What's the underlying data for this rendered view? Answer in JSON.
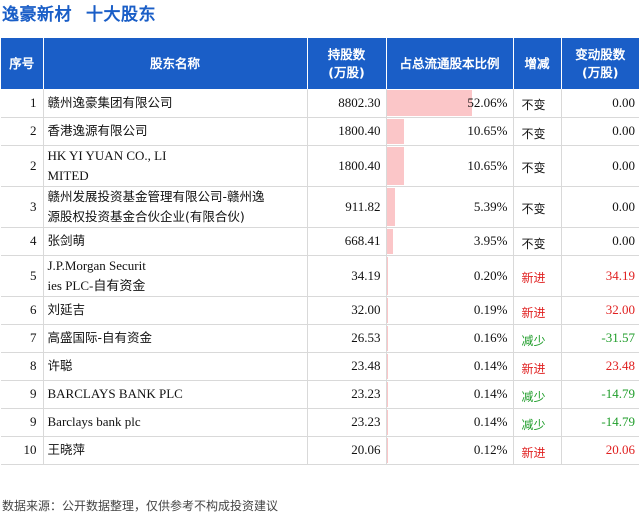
{
  "title": {
    "company": "逸豪新材",
    "section": "十大股东"
  },
  "table": {
    "headers": [
      "序号",
      "股东名称",
      "持股数\n(万股)",
      "占总流通股本比例",
      "增减",
      "变动股数\n(万股)"
    ],
    "rows": [
      {
        "rank": "1",
        "name": [
          "赣州逸豪集团有限公司"
        ],
        "shares": "8802.30",
        "pct": "52.06%",
        "pct_value": 52.06,
        "change": "不变",
        "change_type": "same",
        "delta": "0.00"
      },
      {
        "rank": "2",
        "name": [
          "香港逸源有限公司"
        ],
        "shares": "1800.40",
        "pct": "10.65%",
        "pct_value": 10.65,
        "change": "不变",
        "change_type": "same",
        "delta": "0.00"
      },
      {
        "rank": "2",
        "name": [
          "HK YI YUAN CO., LI",
          "MITED"
        ],
        "shares": "1800.40",
        "pct": "10.65%",
        "pct_value": 10.65,
        "change": "不变",
        "change_type": "same",
        "delta": "0.00"
      },
      {
        "rank": "3",
        "name": [
          "赣州发展投资基金管理有限公司-赣州逸",
          "源股权投资基金合伙企业(有限合伙)"
        ],
        "shares": "911.82",
        "pct": "5.39%",
        "pct_value": 5.39,
        "change": "不变",
        "change_type": "same",
        "delta": "0.00"
      },
      {
        "rank": "4",
        "name": [
          "张剑萌"
        ],
        "shares": "668.41",
        "pct": "3.95%",
        "pct_value": 3.95,
        "change": "不变",
        "change_type": "same",
        "delta": "0.00"
      },
      {
        "rank": "5",
        "name": [
          "J.P.Morgan Securit",
          "ies PLC-自有资金"
        ],
        "shares": "34.19",
        "pct": "0.20%",
        "pct_value": 0.2,
        "change": "新进",
        "change_type": "new",
        "delta": "34.19"
      },
      {
        "rank": "6",
        "name": [
          "刘延吉"
        ],
        "shares": "32.00",
        "pct": "0.19%",
        "pct_value": 0.19,
        "change": "新进",
        "change_type": "new",
        "delta": "32.00"
      },
      {
        "rank": "7",
        "name": [
          "高盛国际-自有资金"
        ],
        "shares": "26.53",
        "pct": "0.16%",
        "pct_value": 0.16,
        "change": "减少",
        "change_type": "down",
        "delta": "-31.57"
      },
      {
        "rank": "8",
        "name": [
          "许聪"
        ],
        "shares": "23.48",
        "pct": "0.14%",
        "pct_value": 0.14,
        "change": "新进",
        "change_type": "new",
        "delta": "23.48"
      },
      {
        "rank": "9",
        "name": [
          "BARCLAYS BANK PLC"
        ],
        "shares": "23.23",
        "pct": "0.14%",
        "pct_value": 0.14,
        "change": "减少",
        "change_type": "down",
        "delta": "-14.79"
      },
      {
        "rank": "9",
        "name": [
          "Barclays bank plc"
        ],
        "shares": "23.23",
        "pct": "0.14%",
        "pct_value": 0.14,
        "change": "减少",
        "change_type": "down",
        "delta": "-14.79"
      },
      {
        "rank": "10",
        "name": [
          "王晓萍"
        ],
        "shares": "20.06",
        "pct": "0.12%",
        "pct_value": 0.12,
        "change": "新进",
        "change_type": "new",
        "delta": "20.06"
      }
    ]
  },
  "colors": {
    "header_bg": "#1a5ec7",
    "bar": "#fbc6c8",
    "new": "#e02020",
    "down": "#1f9d2a",
    "same": "#111111"
  },
  "footer": "数据来源：公开数据整理，仅供参考不构成投资建议"
}
